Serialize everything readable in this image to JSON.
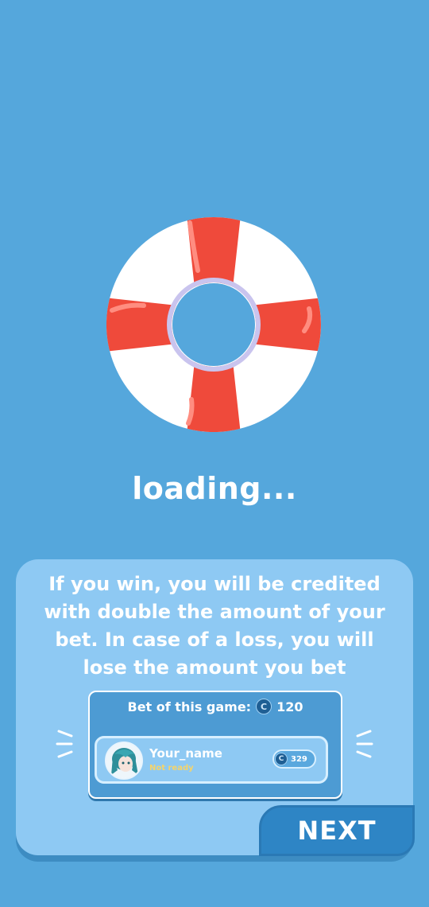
{
  "loading_text": "loading...",
  "info_text": "If you win, you will be credited with double the amount of your bet. In case of a loss, you will lose the amount you bet",
  "bet": {
    "label": "Bet of this game:",
    "coin_symbol": "C",
    "amount": "120"
  },
  "player": {
    "name": "Your_name",
    "status": "Not ready",
    "coin_symbol": "C",
    "coins": "329"
  },
  "next_label": "NEXT",
  "colors": {
    "background": "#55a7dc",
    "card": "#8ec9f3",
    "button": "#2e85c5",
    "buoy_red": "#ef4a3b",
    "status_yellow": "#f5d46a"
  }
}
